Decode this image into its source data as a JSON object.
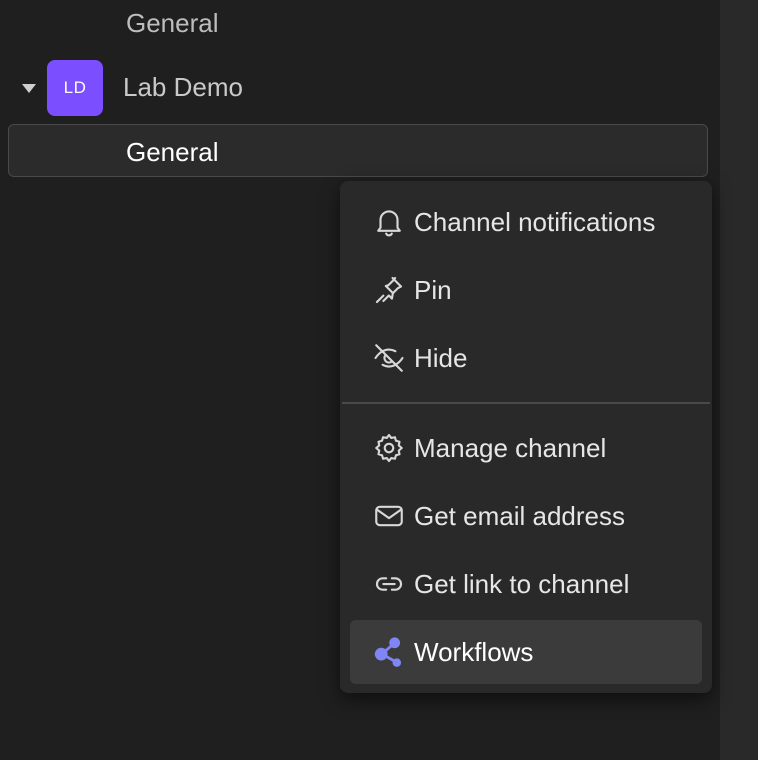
{
  "sidebar": {
    "previous_channel": "General",
    "team": {
      "avatar_initials": "LD",
      "avatar_color": "#7b4fff",
      "name": "Lab Demo"
    },
    "active_channel": "General"
  },
  "context_menu": {
    "items": [
      {
        "label": "Channel notifications",
        "icon": "bell-icon"
      },
      {
        "label": "Pin",
        "icon": "pin-icon"
      },
      {
        "label": "Hide",
        "icon": "eye-off-icon"
      },
      {
        "label": "Manage channel",
        "icon": "gear-icon"
      },
      {
        "label": "Get email address",
        "icon": "envelope-icon"
      },
      {
        "label": "Get link to channel",
        "icon": "link-icon"
      },
      {
        "label": "Workflows",
        "icon": "workflows-icon",
        "accent": "#7f85f5"
      }
    ]
  }
}
